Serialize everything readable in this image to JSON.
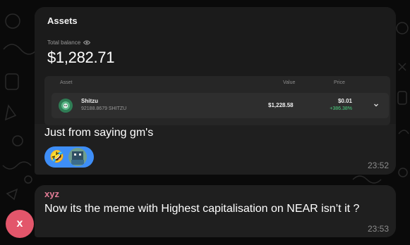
{
  "card": {
    "title": "Assets",
    "balance_label": "Total balance",
    "balance_value": "$1,282.71",
    "columns": {
      "asset": "Asset",
      "value": "Value",
      "price": "Price"
    },
    "row": {
      "name": "Shitzu",
      "amount": "92188.8679 SHITZU",
      "value": "$1,228.58",
      "price": "$0.01",
      "change": "+386.38%"
    }
  },
  "messages": [
    {
      "text": "Just from saying gm's",
      "time": "23:52",
      "reactions": {
        "emoji": "🤣"
      }
    },
    {
      "sender": "xyz",
      "text": "Now its the meme with Highest capitalisation on NEAR isn’t it ?",
      "time": "23:53",
      "avatar_initial": "x"
    }
  ],
  "colors": {
    "bubble": "#1f1f1f",
    "sender": "#e37c96",
    "avatar": "#e3566b",
    "reaction_pill": "#3e8ef7",
    "positive": "#4cd281"
  }
}
